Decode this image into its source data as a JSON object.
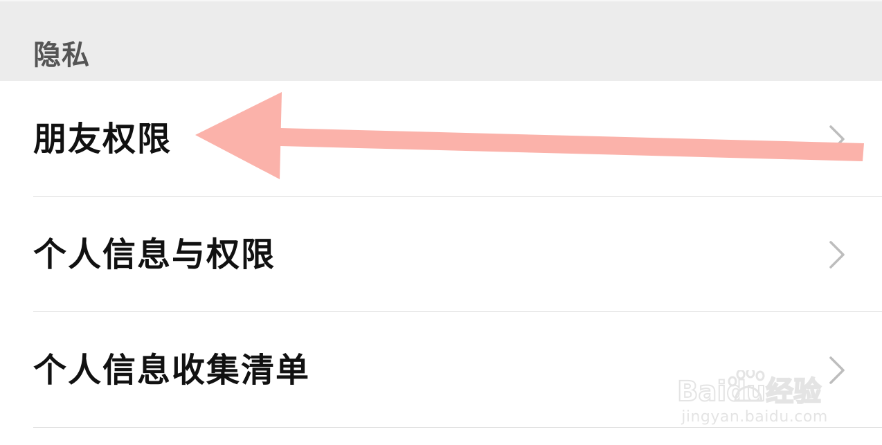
{
  "section": {
    "title": "隐私"
  },
  "items": [
    {
      "label": "朋友权限",
      "icon": "chevron-right-icon"
    },
    {
      "label": "个人信息与权限",
      "icon": "chevron-right-icon"
    },
    {
      "label": "个人信息收集清单",
      "icon": "chevron-right-icon"
    }
  ],
  "annotation": {
    "type": "arrow",
    "color": "#fbb2aa",
    "points_to": "朋友权限"
  },
  "watermark": {
    "logo_text": "Baidu经验",
    "url": "jingyan.baidu.com"
  },
  "colors": {
    "header_bg": "#ececec",
    "header_text": "#555555",
    "item_text": "#111111",
    "chevron": "#bdbdbd",
    "divider": "#dcdcdc"
  }
}
